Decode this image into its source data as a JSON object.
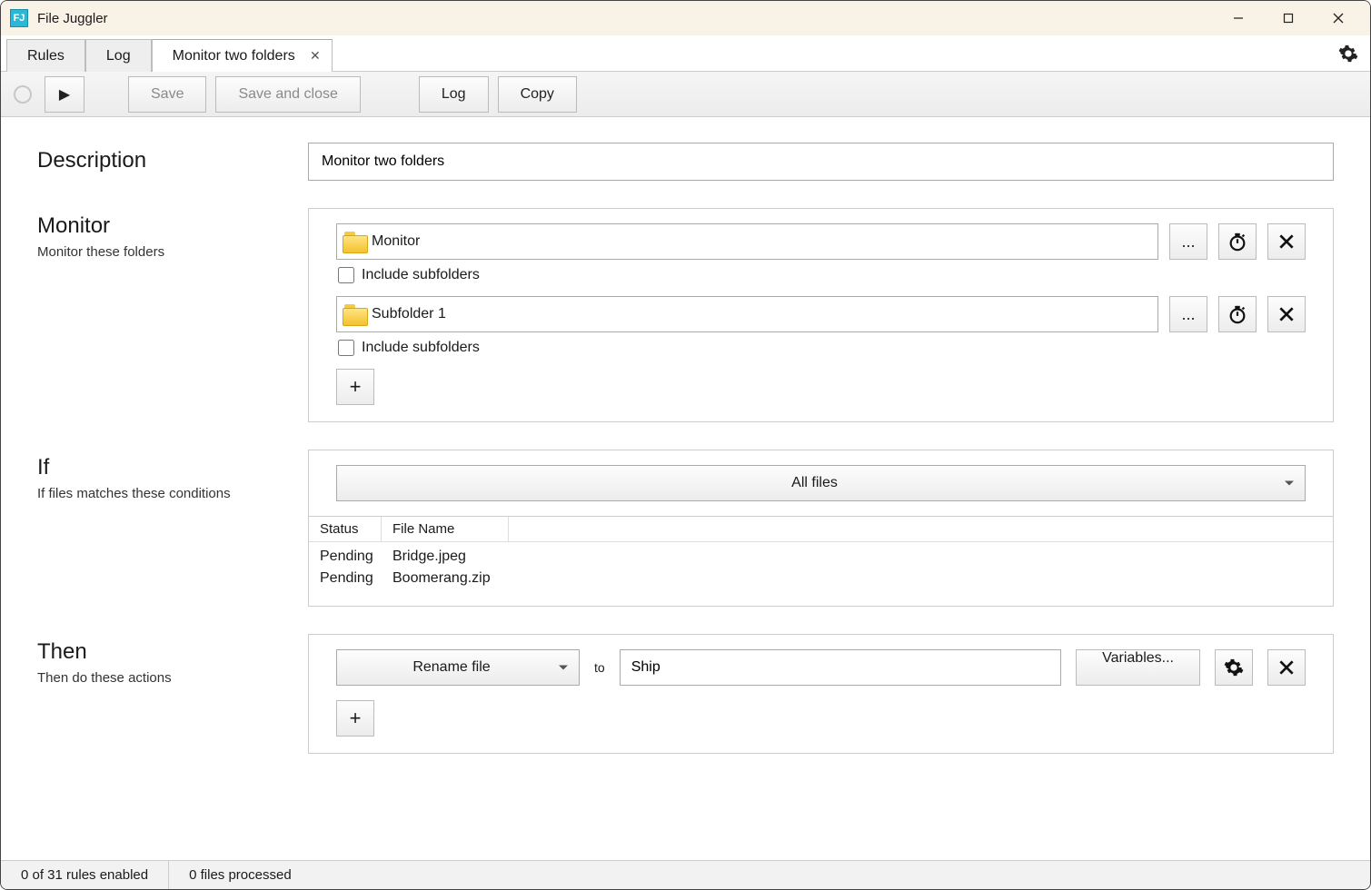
{
  "app": {
    "title": "File Juggler"
  },
  "tabs": [
    {
      "label": "Rules",
      "closable": false,
      "active": false
    },
    {
      "label": "Log",
      "closable": false,
      "active": false
    },
    {
      "label": "Monitor two folders",
      "closable": true,
      "active": true
    }
  ],
  "toolbar": {
    "save": "Save",
    "save_close": "Save and close",
    "log": "Log",
    "copy": "Copy"
  },
  "section_labels": {
    "description": "Description",
    "monitor_title": "Monitor",
    "monitor_sub": "Monitor these folders",
    "if_title": "If",
    "if_sub": "If files matches these conditions",
    "then_title": "Then",
    "then_sub": "Then do these actions"
  },
  "description_value": "Monitor two folders",
  "monitor": {
    "folders": [
      {
        "path": "Monitor",
        "include_subfolders": false
      },
      {
        "path": "Subfolder 1",
        "include_subfolders": false
      }
    ],
    "include_label": "Include subfolders",
    "browse_label": "..."
  },
  "if": {
    "condition_selected": "All files",
    "columns": {
      "status": "Status",
      "filename": "File Name"
    },
    "rows": [
      {
        "status": "Pending",
        "filename": "Bridge.jpeg"
      },
      {
        "status": "Pending",
        "filename": "Boomerang.zip"
      }
    ]
  },
  "then": {
    "action_selected": "Rename file",
    "to_label": "to",
    "value": "Ship",
    "variables_label": "Variables..."
  },
  "statusbar": {
    "rules": "0 of 31 rules enabled",
    "processed": "0 files processed"
  }
}
